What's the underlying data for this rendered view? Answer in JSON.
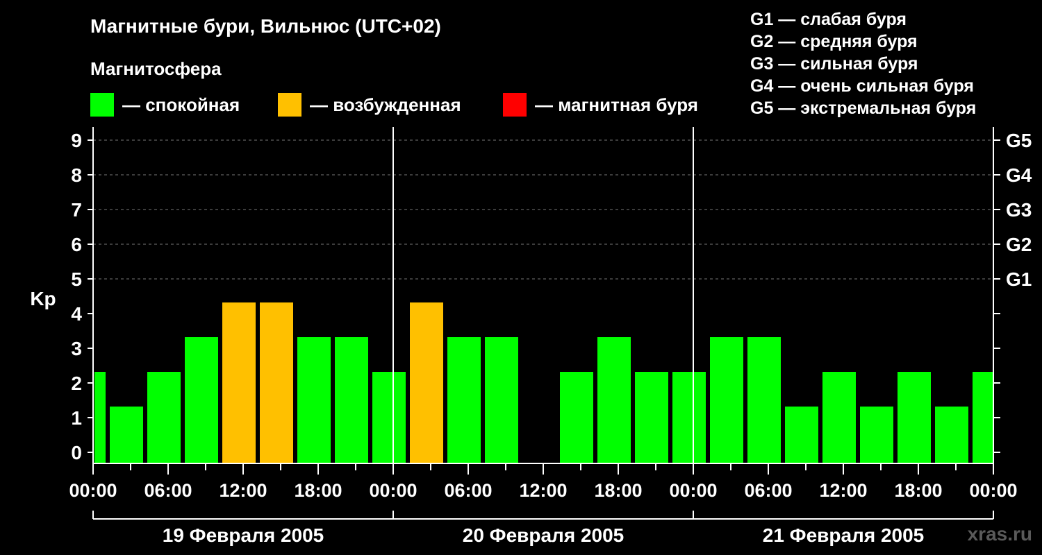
{
  "title": "Магнитные бури, Вильнюс (UTC+02)",
  "subtitle": "Магнитосфера",
  "legend": [
    {
      "color": "#00ff00",
      "label": "— спокойная"
    },
    {
      "color": "#ffc000",
      "label": "— возбужденная"
    },
    {
      "color": "#ff0000",
      "label": "— магнитная буря"
    }
  ],
  "storm_levels": [
    "G1 — слабая буря",
    "G2 — средняя буря",
    "G3 — сильная буря",
    "G4 — очень сильная буря",
    "G5 — экстремальная буря"
  ],
  "watermark": "xras.ru",
  "chart_data": {
    "type": "bar",
    "ylabel": "Kp",
    "ylim": [
      0,
      9
    ],
    "yticks": [
      0,
      1,
      2,
      3,
      4,
      5,
      6,
      7,
      8,
      9
    ],
    "right_ticks": [
      {
        "value": 5,
        "label": "G1"
      },
      {
        "value": 6,
        "label": "G2"
      },
      {
        "value": 7,
        "label": "G3"
      },
      {
        "value": 8,
        "label": "G4"
      },
      {
        "value": 9,
        "label": "G5"
      }
    ],
    "grid": "horizontal dashed at 5–9",
    "xtick_labels": [
      "00:00",
      "06:00",
      "12:00",
      "18:00",
      "00:00",
      "06:00",
      "12:00",
      "18:00",
      "00:00",
      "06:00",
      "12:00",
      "18:00",
      "00:00"
    ],
    "days": [
      "19 Февраля 2005",
      "20 Февраля 2005",
      "21 Февраля 2005"
    ],
    "color_scale": {
      "quiet_max": 3,
      "active": 4,
      "storm_min": 5
    },
    "kp": [
      2,
      1,
      2,
      3,
      4,
      4,
      3,
      3,
      2,
      4,
      3,
      3,
      0,
      2,
      3,
      2,
      2,
      3,
      3,
      1,
      2,
      1,
      2,
      1,
      2
    ]
  }
}
